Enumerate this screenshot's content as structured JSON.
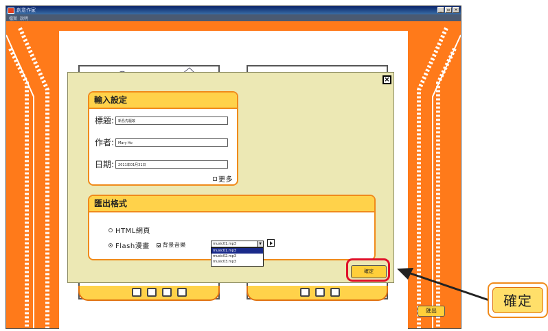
{
  "window": {
    "title": "創意作家",
    "controls": [
      "_",
      "▫",
      "×"
    ]
  },
  "menu": {
    "items": [
      "檔案",
      "說明"
    ]
  },
  "main": {
    "export_button_label": "匯出"
  },
  "dialog": {
    "close_label": "×",
    "input_settings": {
      "heading": "輸入設定",
      "title_label": "標題:",
      "title_value": "新島先驅故",
      "author_label": "作者:",
      "author_value": "Mary Ho",
      "date_label": "日期:",
      "date_value": "2011年01月31日",
      "more_label": "更多",
      "more_checked": false
    },
    "export_format": {
      "heading": "匯出格式",
      "html_label": "HTML網頁",
      "html_selected": false,
      "flash_label": "Flash漫畫",
      "flash_selected": true,
      "bgm_label": "背景音樂",
      "bgm_checked": true,
      "music_selected": "music01.mp3",
      "music_options": [
        "music01.mp3",
        "music02.mp3",
        "music03.mp3"
      ]
    },
    "confirm_label": "確定"
  },
  "callout": {
    "text": "確定"
  },
  "colors": {
    "frame_orange": "#ff7a1a",
    "panel_yellow": "#ffd24a",
    "dialog_bg": "#ece8b4",
    "highlight_red": "#e0102a"
  }
}
